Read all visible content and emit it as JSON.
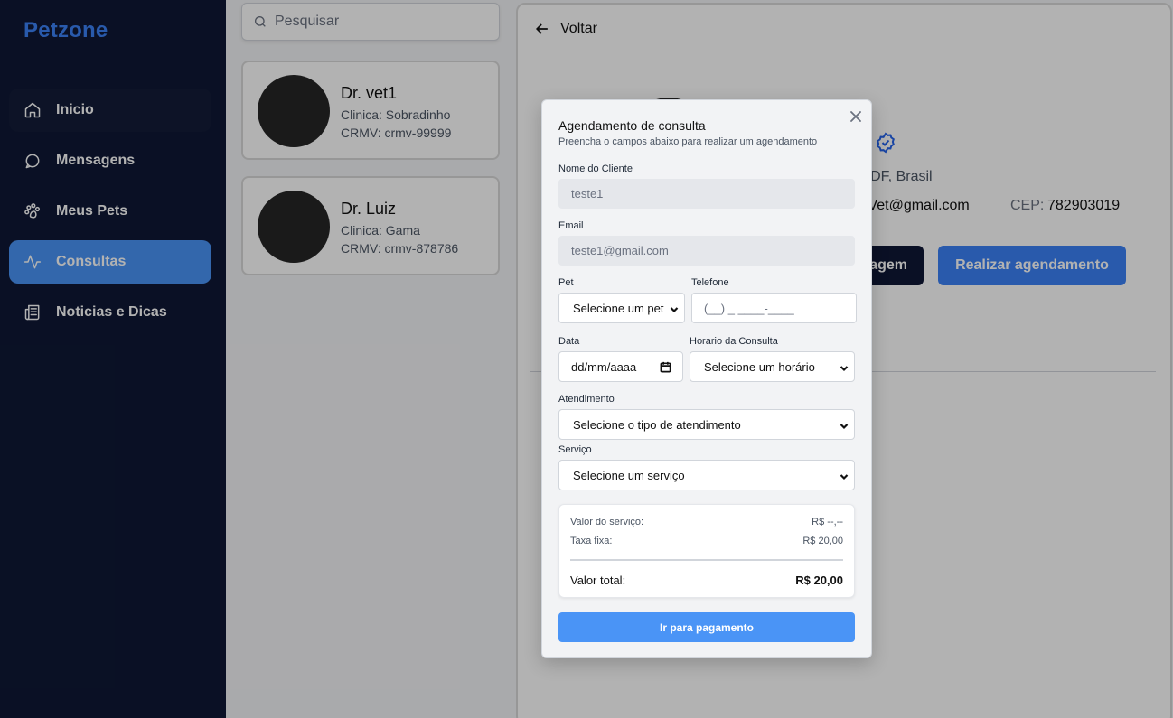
{
  "brand": "Petzone",
  "sidebar": {
    "items": [
      {
        "label": "Inicio",
        "icon": "home-icon"
      },
      {
        "label": "Mensagens",
        "icon": "chat-icon"
      },
      {
        "label": "Meus Pets",
        "icon": "paw-icon"
      },
      {
        "label": "Consultas",
        "icon": "activity-icon"
      },
      {
        "label": "Noticias e Dicas",
        "icon": "newspaper-icon"
      }
    ],
    "active": "Consultas",
    "active_color": "#4a94f6",
    "background": "#0f1835"
  },
  "search": {
    "placeholder": "Pesquisar"
  },
  "vets": [
    {
      "name": "Dr. vet1",
      "clinic": "Clinica: Sobradinho",
      "crmv": "CRMV: crmv-99999"
    },
    {
      "name": "Dr. Luiz",
      "clinic": "Clinica: Gama",
      "crmv": "CRMV: crmv-878786"
    }
  ],
  "detail": {
    "back_label": "Voltar",
    "location_partial": "na-DF, Brasil",
    "email_partial": "uizVet@gmail.com",
    "cep_label": "CEP:",
    "cep_value": "782903019",
    "dark_button_partial": "agem",
    "schedule_button": "Realizar agendamento"
  },
  "modal": {
    "title": "Agendamento de consulta",
    "subtitle": "Preencha o campos abaixo para realizar um agendamento",
    "client_label": "Nome do Cliente",
    "client_value": "teste1",
    "email_label": "Email",
    "email_value": "teste1@gmail.com",
    "pet_label": "Pet",
    "pet_value": "Selecione um pet",
    "phone_label": "Telefone",
    "phone_placeholder": "(__) _ ____-____",
    "date_label": "Data",
    "date_placeholder": "dd/mm/aaaa",
    "time_label": "Horario da Consulta",
    "time_value": "Selecione um horário",
    "attendance_label": "Atendimento",
    "attendance_value": "Selecione o tipo de atendimento",
    "service_label": "Serviço",
    "service_value": "Selecione um serviço",
    "summary": {
      "service_label": "Valor do serviço:",
      "service_value": "R$ --,--",
      "fee_label": "Taxa fixa:",
      "fee_value": "R$ 20,00",
      "total_label": "Valor total:",
      "total_value": "R$ 20,00"
    },
    "pay_button": "Ir para pagamento"
  }
}
